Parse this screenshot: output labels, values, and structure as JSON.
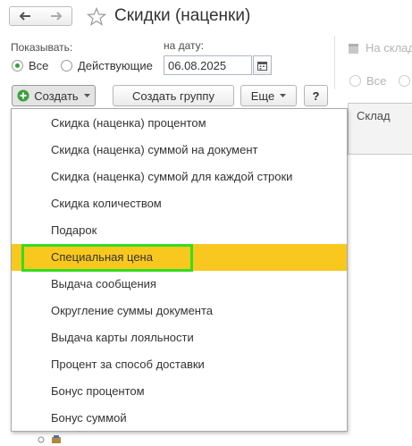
{
  "header": {
    "title": "Скидки (наценки)",
    "back_icon": "arrow-left-icon",
    "forward_icon": "arrow-right-icon",
    "favorite_icon": "star-outline-icon"
  },
  "filters": {
    "show_label": "Показывать:",
    "option_all": "Все",
    "option_active": "Действующие",
    "selected": "Все",
    "date_label": "на дату:",
    "date_value": "06.08.2025"
  },
  "toolbar": {
    "create_label": "Создать",
    "create_group_label": "Создать группу",
    "more_label": "Еще",
    "help_label": "?"
  },
  "right_panel": {
    "warehouse_filter_label": "На склад",
    "option_all": "Все",
    "column_warehouse": "Склад"
  },
  "create_menu": {
    "items": [
      {
        "label": "Скидка (наценка) процентом"
      },
      {
        "label": "Скидка (наценка) суммой на документ"
      },
      {
        "label": "Скидка (наценка) суммой для каждой строки"
      },
      {
        "label": "Скидка количеством"
      },
      {
        "label": "Подарок"
      },
      {
        "label": "Специальная цена"
      },
      {
        "label": "Выдача сообщения"
      },
      {
        "label": "Округление суммы документа"
      },
      {
        "label": "Выдача карты лояльности"
      },
      {
        "label": "Процент за способ доставки"
      },
      {
        "label": "Бонус процентом"
      },
      {
        "label": "Бонус суммой"
      }
    ],
    "selected_index": 5
  },
  "colors": {
    "selected_row": "#f9c81f",
    "highlight_border": "#33dd22",
    "create_plus": "#3aa13a"
  }
}
